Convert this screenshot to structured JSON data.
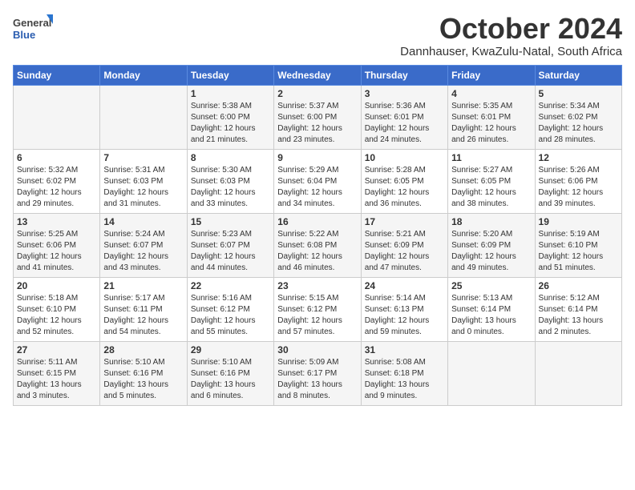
{
  "logo": {
    "general": "General",
    "blue": "Blue"
  },
  "header": {
    "month": "October 2024",
    "location": "Dannhauser, KwaZulu-Natal, South Africa"
  },
  "weekdays": [
    "Sunday",
    "Monday",
    "Tuesday",
    "Wednesday",
    "Thursday",
    "Friday",
    "Saturday"
  ],
  "weeks": [
    [
      {
        "day": "",
        "info": ""
      },
      {
        "day": "",
        "info": ""
      },
      {
        "day": "1",
        "info": "Sunrise: 5:38 AM\nSunset: 6:00 PM\nDaylight: 12 hours and 21 minutes."
      },
      {
        "day": "2",
        "info": "Sunrise: 5:37 AM\nSunset: 6:00 PM\nDaylight: 12 hours and 23 minutes."
      },
      {
        "day": "3",
        "info": "Sunrise: 5:36 AM\nSunset: 6:01 PM\nDaylight: 12 hours and 24 minutes."
      },
      {
        "day": "4",
        "info": "Sunrise: 5:35 AM\nSunset: 6:01 PM\nDaylight: 12 hours and 26 minutes."
      },
      {
        "day": "5",
        "info": "Sunrise: 5:34 AM\nSunset: 6:02 PM\nDaylight: 12 hours and 28 minutes."
      }
    ],
    [
      {
        "day": "6",
        "info": "Sunrise: 5:32 AM\nSunset: 6:02 PM\nDaylight: 12 hours and 29 minutes."
      },
      {
        "day": "7",
        "info": "Sunrise: 5:31 AM\nSunset: 6:03 PM\nDaylight: 12 hours and 31 minutes."
      },
      {
        "day": "8",
        "info": "Sunrise: 5:30 AM\nSunset: 6:03 PM\nDaylight: 12 hours and 33 minutes."
      },
      {
        "day": "9",
        "info": "Sunrise: 5:29 AM\nSunset: 6:04 PM\nDaylight: 12 hours and 34 minutes."
      },
      {
        "day": "10",
        "info": "Sunrise: 5:28 AM\nSunset: 6:05 PM\nDaylight: 12 hours and 36 minutes."
      },
      {
        "day": "11",
        "info": "Sunrise: 5:27 AM\nSunset: 6:05 PM\nDaylight: 12 hours and 38 minutes."
      },
      {
        "day": "12",
        "info": "Sunrise: 5:26 AM\nSunset: 6:06 PM\nDaylight: 12 hours and 39 minutes."
      }
    ],
    [
      {
        "day": "13",
        "info": "Sunrise: 5:25 AM\nSunset: 6:06 PM\nDaylight: 12 hours and 41 minutes."
      },
      {
        "day": "14",
        "info": "Sunrise: 5:24 AM\nSunset: 6:07 PM\nDaylight: 12 hours and 43 minutes."
      },
      {
        "day": "15",
        "info": "Sunrise: 5:23 AM\nSunset: 6:07 PM\nDaylight: 12 hours and 44 minutes."
      },
      {
        "day": "16",
        "info": "Sunrise: 5:22 AM\nSunset: 6:08 PM\nDaylight: 12 hours and 46 minutes."
      },
      {
        "day": "17",
        "info": "Sunrise: 5:21 AM\nSunset: 6:09 PM\nDaylight: 12 hours and 47 minutes."
      },
      {
        "day": "18",
        "info": "Sunrise: 5:20 AM\nSunset: 6:09 PM\nDaylight: 12 hours and 49 minutes."
      },
      {
        "day": "19",
        "info": "Sunrise: 5:19 AM\nSunset: 6:10 PM\nDaylight: 12 hours and 51 minutes."
      }
    ],
    [
      {
        "day": "20",
        "info": "Sunrise: 5:18 AM\nSunset: 6:10 PM\nDaylight: 12 hours and 52 minutes."
      },
      {
        "day": "21",
        "info": "Sunrise: 5:17 AM\nSunset: 6:11 PM\nDaylight: 12 hours and 54 minutes."
      },
      {
        "day": "22",
        "info": "Sunrise: 5:16 AM\nSunset: 6:12 PM\nDaylight: 12 hours and 55 minutes."
      },
      {
        "day": "23",
        "info": "Sunrise: 5:15 AM\nSunset: 6:12 PM\nDaylight: 12 hours and 57 minutes."
      },
      {
        "day": "24",
        "info": "Sunrise: 5:14 AM\nSunset: 6:13 PM\nDaylight: 12 hours and 59 minutes."
      },
      {
        "day": "25",
        "info": "Sunrise: 5:13 AM\nSunset: 6:14 PM\nDaylight: 13 hours and 0 minutes."
      },
      {
        "day": "26",
        "info": "Sunrise: 5:12 AM\nSunset: 6:14 PM\nDaylight: 13 hours and 2 minutes."
      }
    ],
    [
      {
        "day": "27",
        "info": "Sunrise: 5:11 AM\nSunset: 6:15 PM\nDaylight: 13 hours and 3 minutes."
      },
      {
        "day": "28",
        "info": "Sunrise: 5:10 AM\nSunset: 6:16 PM\nDaylight: 13 hours and 5 minutes."
      },
      {
        "day": "29",
        "info": "Sunrise: 5:10 AM\nSunset: 6:16 PM\nDaylight: 13 hours and 6 minutes."
      },
      {
        "day": "30",
        "info": "Sunrise: 5:09 AM\nSunset: 6:17 PM\nDaylight: 13 hours and 8 minutes."
      },
      {
        "day": "31",
        "info": "Sunrise: 5:08 AM\nSunset: 6:18 PM\nDaylight: 13 hours and 9 minutes."
      },
      {
        "day": "",
        "info": ""
      },
      {
        "day": "",
        "info": ""
      }
    ]
  ]
}
